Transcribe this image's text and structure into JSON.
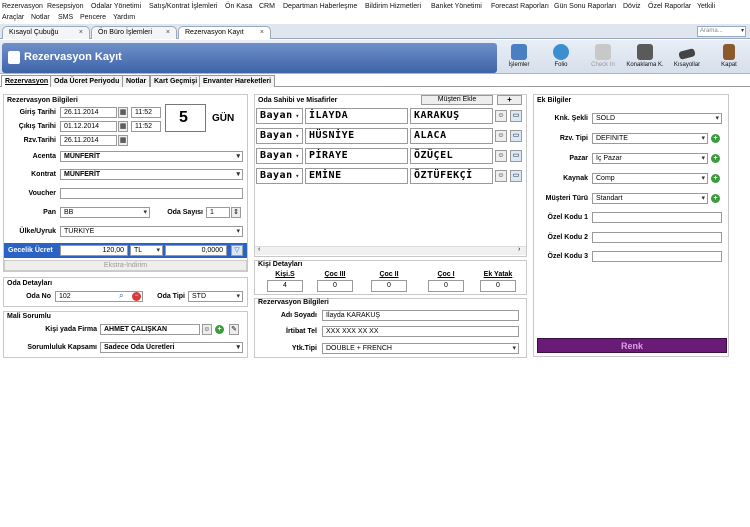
{
  "menu": {
    "row1": [
      "Rezervasyon",
      "Resepsiyon",
      "Odalar Yönetimi",
      "Satış/Kontrat İşlemleri",
      "Ön Kasa",
      "CRM",
      "Departman Haberleşme",
      "Bildirim Hizmetleri",
      "Banket Yönetimi",
      "Forecast Raporları",
      "Gün Sonu Raporları",
      "Döviz",
      "Özel Raporlar",
      "Yetkili"
    ],
    "row2": [
      "Araçlar",
      "Notlar",
      "SMS",
      "Pencere",
      "Yardım"
    ]
  },
  "doc_tabs": [
    {
      "label": "Kısayol Çubuğu",
      "close": "×"
    },
    {
      "label": "Ön Büro İşlemleri",
      "close": "×"
    },
    {
      "label": "Rezervasyon Kayıt",
      "close": "×"
    }
  ],
  "search": {
    "placeholder": "Arama...",
    "arrow": "▾"
  },
  "window_title": "Rezervasyon Kayıt",
  "toolbar": [
    {
      "label": "İşlemler",
      "icon": "gears-icon",
      "color": "#4a7fc4"
    },
    {
      "label": "Folio",
      "icon": "folio-icon",
      "color": "#3b8fd0"
    },
    {
      "label": "Check In",
      "icon": "monitor-icon",
      "color": "#b8b8b8"
    },
    {
      "label": "Konaklama K.",
      "icon": "printer-icon",
      "color": "#5a5a5a"
    },
    {
      "label": "Kısayollar",
      "icon": "keyboard-icon",
      "color": "#444444"
    },
    {
      "label": "Kapat",
      "icon": "exit-door-icon",
      "color": "#8a5a2a"
    }
  ],
  "form_tabs": [
    "Rezervasyon",
    "Oda Ücret Periyodu",
    "Notlar",
    "Kart Geçmişi",
    "Envanter Hareketleri"
  ],
  "reservation": {
    "header": "Rezervasyon Bilgileri",
    "giris_label": "Giriş Tarihi",
    "giris_date": "26.11.2014",
    "giris_time": "11:52",
    "cikis_label": "Çıkış Tarihi",
    "cikis_date": "01.12.2014",
    "cikis_time": "11:52",
    "rzv_label": "Rzv.Tarihi",
    "rzv_date": "26.11.2014",
    "nights": "5",
    "nights_unit": "GÜN",
    "acenta_label": "Acenta",
    "acenta": "MÜNFERİT",
    "kontrat_label": "Kontrat",
    "kontrat": "MÜNFERİT",
    "voucher_label": "Voucher",
    "voucher": "",
    "pan_label": "Pan",
    "pan": "BB",
    "oda_sayisi_label": "Oda Sayısı",
    "oda_sayisi": "1",
    "ulke_label": "Ülke/Uyruk",
    "ulke": "TÜRKİYE",
    "gecelik_label": "Gecelik Ücret",
    "gecelik": "120,00",
    "currency": "TL",
    "rate": "0,0000",
    "ekstra": "Ekstra-İndirim"
  },
  "room": {
    "header": "Oda Detayları",
    "no_label": "Oda No",
    "no": "102",
    "tipi_label": "Oda Tipi",
    "tipi": "STD"
  },
  "mali": {
    "header": "Mali Sorumlu",
    "kisi_label": "Kişi yada Firma",
    "kisi": "AHMET ÇALIŞKAN",
    "kapsam_label": "Sorumluluk Kapsamı",
    "kapsam": "Sadece Oda Ücretleri"
  },
  "guests": {
    "header": "Oda Sahibi ve Misafirler",
    "add_button": "Müşteri Ekle",
    "plus": "+",
    "rows": [
      {
        "title": "Bayan",
        "first": "İLAYDA",
        "last": "KARAKUŞ"
      },
      {
        "title": "Bayan",
        "first": "HÜSNİYE",
        "last": "ALACA"
      },
      {
        "title": "Bayan",
        "first": "PİRAYE",
        "last": "ÖZÜÇEL"
      },
      {
        "title": "Bayan",
        "first": "EMİNE",
        "last": "ÖZTÜFEKÇİ"
      }
    ]
  },
  "kisi": {
    "header": "Kişi Detayları",
    "cols": [
      {
        "label": "Kişi.S",
        "value": "4"
      },
      {
        "label": "Çoc III",
        "value": "0"
      },
      {
        "label": "Çoc II",
        "value": "0"
      },
      {
        "label": "Çoc I",
        "value": "0"
      },
      {
        "label": "Ek Yatak",
        "value": "0"
      }
    ]
  },
  "contact": {
    "header": "Rezervasyon Bilgileri",
    "ad_label": "Adı Soyadı",
    "ad": "İlayda KARAKUŞ",
    "tel_label": "İrtibat Tel",
    "tel": "XXX XXX XX XX",
    "ytk_label": "Ytk.Tipi",
    "ytk": "DOUBLE + FRENCH"
  },
  "ek": {
    "header": "Ek Bilgiler",
    "knk_label": "Knk. Şekli",
    "knk": "SOLD",
    "rzv_tipi_label": "Rzv. Tipi",
    "rzv_tipi": "DEFINITE",
    "pazar_label": "Pazar",
    "pazar": "İç Pazar",
    "kaynak_label": "Kaynak",
    "kaynak": "Comp",
    "musteri_label": "Müşteri Türü",
    "musteri": "Standart",
    "ozel1_label": "Özel Kodu 1",
    "ozel2_label": "Özel Kodu 2",
    "ozel3_label": "Özel Kodu 3",
    "renk": "Renk"
  },
  "colors": {
    "title_bg": "#3e63a8",
    "gecelik_bg": "#2a63c4",
    "renk_bg": "#6a1b78"
  }
}
